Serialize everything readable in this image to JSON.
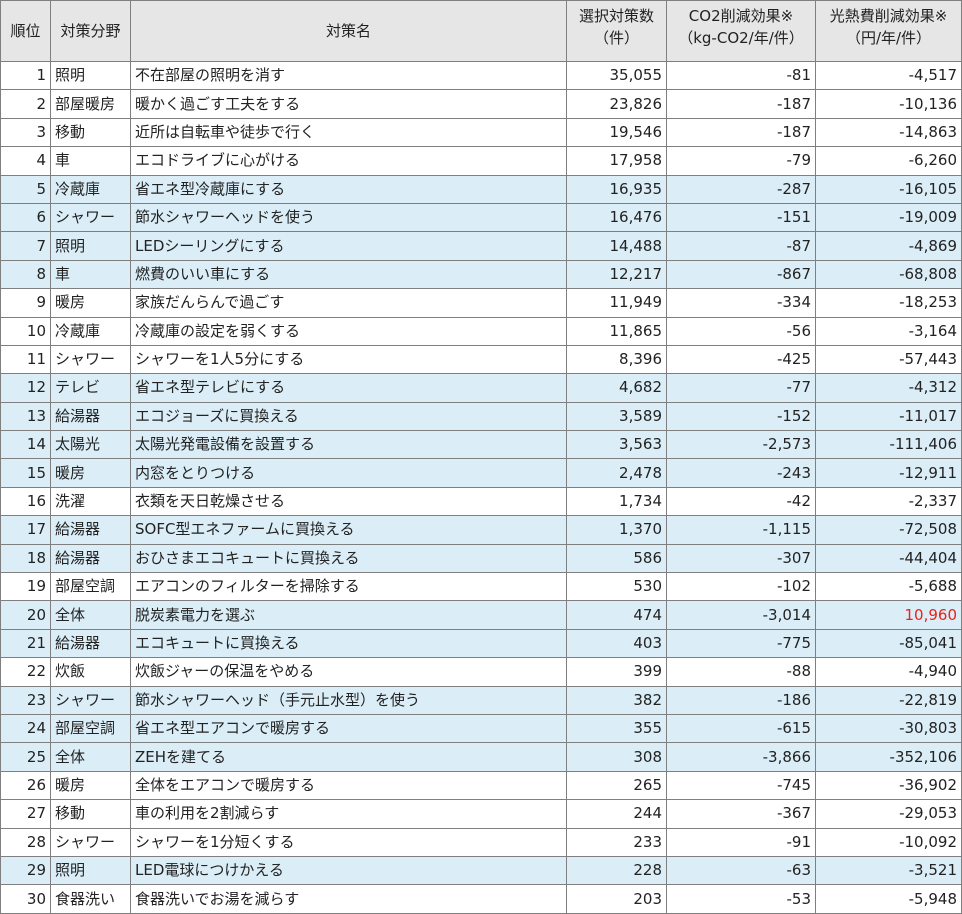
{
  "headers": {
    "rank": "順位",
    "field": "対策分野",
    "name": "対策名",
    "count_l1": "選択対策数",
    "count_l2": "（件）",
    "co2_l1": "CO2削減効果※",
    "co2_l2": "（kg-CO2/年/件）",
    "cost_l1": "光熱費削減効果※",
    "cost_l2": "（円/年/件）"
  },
  "colors": {
    "highlight_row": "#dbeef7",
    "header_bg": "#e6e6e6",
    "positive_value": "#e8231a"
  },
  "rows": [
    {
      "rank": "1",
      "field": "照明",
      "name": "不在部屋の照明を消す",
      "count": "35,055",
      "co2": "-81",
      "cost": "-4,517",
      "highlighted": false
    },
    {
      "rank": "2",
      "field": "部屋暖房",
      "name": "暖かく過ごす工夫をする",
      "count": "23,826",
      "co2": "-187",
      "cost": "-10,136",
      "highlighted": false
    },
    {
      "rank": "3",
      "field": "移動",
      "name": "近所は自転車や徒歩で行く",
      "count": "19,546",
      "co2": "-187",
      "cost": "-14,863",
      "highlighted": false
    },
    {
      "rank": "4",
      "field": "車",
      "name": "エコドライブに心がける",
      "count": "17,958",
      "co2": "-79",
      "cost": "-6,260",
      "highlighted": false
    },
    {
      "rank": "5",
      "field": "冷蔵庫",
      "name": "省エネ型冷蔵庫にする",
      "count": "16,935",
      "co2": "-287",
      "cost": "-16,105",
      "highlighted": true
    },
    {
      "rank": "6",
      "field": "シャワー",
      "name": "節水シャワーヘッドを使う",
      "count": "16,476",
      "co2": "-151",
      "cost": "-19,009",
      "highlighted": true
    },
    {
      "rank": "7",
      "field": "照明",
      "name": "LEDシーリングにする",
      "count": "14,488",
      "co2": "-87",
      "cost": "-4,869",
      "highlighted": true
    },
    {
      "rank": "8",
      "field": "車",
      "name": "燃費のいい車にする",
      "count": "12,217",
      "co2": "-867",
      "cost": "-68,808",
      "highlighted": true
    },
    {
      "rank": "9",
      "field": "暖房",
      "name": "家族だんらんで過ごす",
      "count": "11,949",
      "co2": "-334",
      "cost": "-18,253",
      "highlighted": false
    },
    {
      "rank": "10",
      "field": "冷蔵庫",
      "name": "冷蔵庫の設定を弱くする",
      "count": "11,865",
      "co2": "-56",
      "cost": "-3,164",
      "highlighted": false
    },
    {
      "rank": "11",
      "field": "シャワー",
      "name": "シャワーを1人5分にする",
      "count": "8,396",
      "co2": "-425",
      "cost": "-57,443",
      "highlighted": false
    },
    {
      "rank": "12",
      "field": "テレビ",
      "name": "省エネ型テレビにする",
      "count": "4,682",
      "co2": "-77",
      "cost": "-4,312",
      "highlighted": true
    },
    {
      "rank": "13",
      "field": "給湯器",
      "name": "エコジョーズに買換える",
      "count": "3,589",
      "co2": "-152",
      "cost": "-11,017",
      "highlighted": true
    },
    {
      "rank": "14",
      "field": "太陽光",
      "name": "太陽光発電設備を設置する",
      "count": "3,563",
      "co2": "-2,573",
      "cost": "-111,406",
      "highlighted": true
    },
    {
      "rank": "15",
      "field": "暖房",
      "name": "内窓をとりつける",
      "count": "2,478",
      "co2": "-243",
      "cost": "-12,911",
      "highlighted": true
    },
    {
      "rank": "16",
      "field": "洗濯",
      "name": "衣類を天日乾燥させる",
      "count": "1,734",
      "co2": "-42",
      "cost": "-2,337",
      "highlighted": false
    },
    {
      "rank": "17",
      "field": "給湯器",
      "name": "SOFC型エネファームに買換える",
      "count": "1,370",
      "co2": "-1,115",
      "cost": "-72,508",
      "highlighted": true
    },
    {
      "rank": "18",
      "field": "給湯器",
      "name": "おひさまエコキュートに買換える",
      "count": "586",
      "co2": "-307",
      "cost": "-44,404",
      "highlighted": true
    },
    {
      "rank": "19",
      "field": "部屋空調",
      "name": "エアコンのフィルターを掃除する",
      "count": "530",
      "co2": "-102",
      "cost": "-5,688",
      "highlighted": false
    },
    {
      "rank": "20",
      "field": "全体",
      "name": "脱炭素電力を選ぶ",
      "count": "474",
      "co2": "-3,014",
      "cost": "10,960",
      "highlighted": true,
      "cost_positive": true
    },
    {
      "rank": "21",
      "field": "給湯器",
      "name": "エコキュートに買換える",
      "count": "403",
      "co2": "-775",
      "cost": "-85,041",
      "highlighted": true
    },
    {
      "rank": "22",
      "field": "炊飯",
      "name": "炊飯ジャーの保温をやめる",
      "count": "399",
      "co2": "-88",
      "cost": "-4,940",
      "highlighted": false
    },
    {
      "rank": "23",
      "field": "シャワー",
      "name": "節水シャワーヘッド（手元止水型）を使う",
      "count": "382",
      "co2": "-186",
      "cost": "-22,819",
      "highlighted": true
    },
    {
      "rank": "24",
      "field": "部屋空調",
      "name": "省エネ型エアコンで暖房する",
      "count": "355",
      "co2": "-615",
      "cost": "-30,803",
      "highlighted": true
    },
    {
      "rank": "25",
      "field": "全体",
      "name": "ZEHを建てる",
      "count": "308",
      "co2": "-3,866",
      "cost": "-352,106",
      "highlighted": true
    },
    {
      "rank": "26",
      "field": "暖房",
      "name": "全体をエアコンで暖房する",
      "count": "265",
      "co2": "-745",
      "cost": "-36,902",
      "highlighted": false
    },
    {
      "rank": "27",
      "field": "移動",
      "name": "車の利用を2割減らす",
      "count": "244",
      "co2": "-367",
      "cost": "-29,053",
      "highlighted": false
    },
    {
      "rank": "28",
      "field": "シャワー",
      "name": "シャワーを1分短くする",
      "count": "233",
      "co2": "-91",
      "cost": "-10,092",
      "highlighted": false
    },
    {
      "rank": "29",
      "field": "照明",
      "name": "LED電球につけかえる",
      "count": "228",
      "co2": "-63",
      "cost": "-3,521",
      "highlighted": true
    },
    {
      "rank": "30",
      "field": "食器洗い",
      "name": "食器洗いでお湯を減らす",
      "count": "203",
      "co2": "-53",
      "cost": "-5,948",
      "highlighted": false
    }
  ]
}
